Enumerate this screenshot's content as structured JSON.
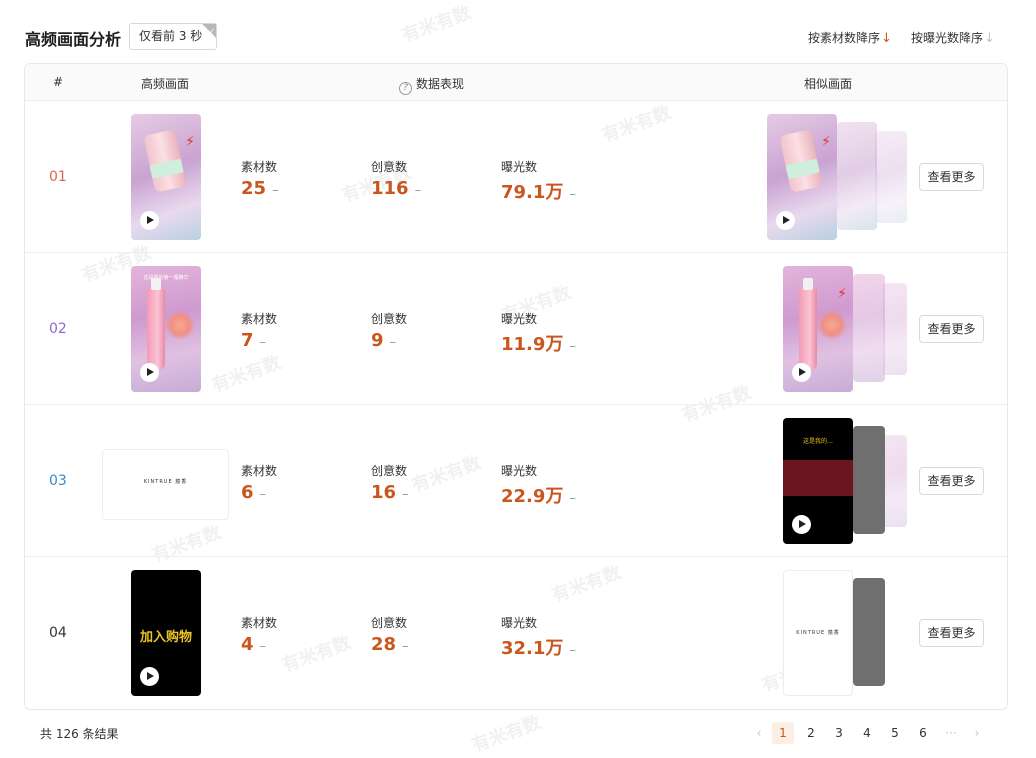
{
  "header": {
    "title": "高频画面分析",
    "filter_tag": "仅看前 3 秒",
    "sort_material": "按素材数降序",
    "sort_exposure": "按曝光数降序",
    "arrow_down": "↓"
  },
  "table": {
    "col_index": "#",
    "col_frame": "高频画面",
    "col_metrics": "数据表现",
    "col_similar": "相似画面",
    "help_icon": "?"
  },
  "metric_labels": {
    "material": "素材数",
    "creative": "创意数",
    "exposure": "曝光数"
  },
  "trend_symbol": "–",
  "rows": [
    {
      "index": "01",
      "index_color": "#d9694e",
      "material": "25",
      "creative": "116",
      "exposure": "79.1万",
      "more": "查看更多"
    },
    {
      "index": "02",
      "index_color": "#8c6bc8",
      "material": "7",
      "creative": "9",
      "exposure": "11.9万",
      "more": "查看更多",
      "caption": "这是我的第一瓶精华"
    },
    {
      "index": "03",
      "index_color": "#3a8bc9",
      "material": "6",
      "creative": "16",
      "exposure": "22.9万",
      "more": "查看更多",
      "brand": "KINTRUE 蕴香",
      "similar_caption": "这是我的…"
    },
    {
      "index": "04",
      "index_color": "#333333",
      "material": "4",
      "creative": "28",
      "exposure": "32.1万",
      "more": "查看更多",
      "overlay": "加入购物",
      "brand": "KINTRUE 蕴香"
    }
  ],
  "footer": {
    "total": "共 126 条结果",
    "prev": "‹",
    "next": "›",
    "pages": [
      "1",
      "2",
      "3",
      "4",
      "5",
      "6"
    ],
    "ellipsis": "···",
    "current_page": "1"
  },
  "watermark": "有米有数",
  "colors": {
    "accent": "#c9571d",
    "active_page_bg": "#fdeee4"
  }
}
